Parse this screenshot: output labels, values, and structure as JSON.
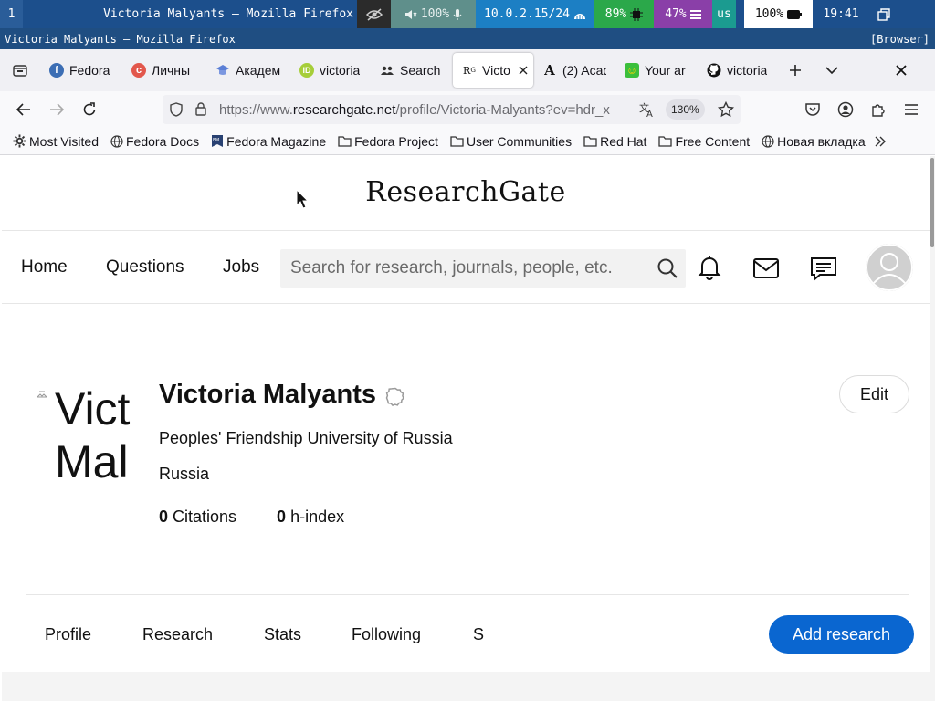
{
  "sysbar": {
    "workspace": "1",
    "window_title": "Victoria Malyants — Mozilla Firefox",
    "volume": "100%",
    "network": "10.0.2.15/24",
    "cpu": "89%",
    "memory": "47%",
    "keyboard_layout": "us",
    "battery": "100%",
    "clock": "19:41"
  },
  "titlebar": {
    "title": "Victoria Malyants — Mozilla Firefox",
    "mode": "[Browser]"
  },
  "tabs": [
    {
      "label": "Fedora",
      "icon": "fedora-icon",
      "color": "#3c6eb4"
    },
    {
      "label": "Личны",
      "icon": "tab-red-icon",
      "color": "#e2574c"
    },
    {
      "label": "Академ",
      "icon": "academia-icon",
      "color": "#5b7fd6"
    },
    {
      "label": "victoria",
      "icon": "orcid-icon",
      "color": "#a6ce39"
    },
    {
      "label": "Search",
      "icon": "people-search-icon",
      "color": "#333333"
    },
    {
      "label": "Victo",
      "icon": "researchgate-icon",
      "color": "#111111",
      "active": true
    },
    {
      "label": "(2) Acad",
      "icon": "letter-a-icon",
      "color": "#111111"
    },
    {
      "label": "Your ar",
      "icon": "smiley-icon",
      "color": "#3bbf3b"
    },
    {
      "label": "victoria",
      "icon": "github-icon",
      "color": "#111111"
    }
  ],
  "urlbar": {
    "prefix": "https://www.",
    "domain": "researchgate.net",
    "path": "/profile/Victoria-Malyants?ev=hdr_x",
    "zoom": "130%"
  },
  "bookmarks": [
    {
      "label": "Most Visited",
      "icon": "gear-icon"
    },
    {
      "label": "Fedora Docs",
      "icon": "globe-icon"
    },
    {
      "label": "Fedora Magazine",
      "icon": "fm-icon"
    },
    {
      "label": "Fedora Project",
      "icon": "folder-icon"
    },
    {
      "label": "User Communities",
      "icon": "folder-icon"
    },
    {
      "label": "Red Hat",
      "icon": "folder-icon"
    },
    {
      "label": "Free Content",
      "icon": "folder-icon"
    },
    {
      "label": "Новая вкладка",
      "icon": "globe-icon"
    }
  ],
  "rg": {
    "logo": "ResearchGate",
    "nav": {
      "home": "Home",
      "questions": "Questions",
      "jobs": "Jobs"
    },
    "search_placeholder": "Search for research, journals, people, etc.",
    "profile": {
      "photo_text_line1": "Vict",
      "photo_text_line2": "Mal",
      "name": "Victoria Malyants",
      "institution": "Peoples' Friendship University of Russia",
      "country": "Russia",
      "citations_value": "0",
      "citations_label": "Citations",
      "hindex_value": "0",
      "hindex_label": "h-index",
      "edit_label": "Edit"
    },
    "profile_tabs": [
      "Profile",
      "Research",
      "Stats",
      "Following",
      "S"
    ],
    "add_research_label": "Add research",
    "accent": "#0a66d0"
  }
}
